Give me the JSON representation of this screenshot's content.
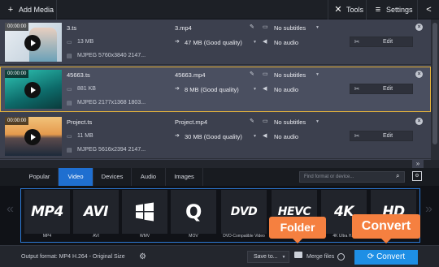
{
  "toolbar": {
    "add_media": "Add Media",
    "tools": "Tools",
    "settings": "Settings"
  },
  "files": [
    {
      "duration": "00:00:00",
      "name": "3.ts",
      "size": "13 MB",
      "codec": "MJPEG 5760x3840 2147...",
      "output_name": "3.mp4",
      "output_size": "47 MB (Good quality)",
      "subtitles": "No subtitles",
      "audio": "No audio",
      "edit": "Edit",
      "selected": false
    },
    {
      "duration": "00:00:00",
      "name": "45663.ts",
      "size": "881 KB",
      "codec": "MJPEG 2177x1368 1803...",
      "output_name": "45663.mp4",
      "output_size": "8 MB (Good quality)",
      "subtitles": "No subtitles",
      "audio": "No audio",
      "edit": "Edit",
      "selected": true
    },
    {
      "duration": "00:00:00",
      "name": "Project.ts",
      "size": "11 MB",
      "codec": "MJPEG 5616x2394 2147...",
      "output_name": "Project.mp4",
      "output_size": "30 MB (Good quality)",
      "subtitles": "No subtitles",
      "audio": "No audio",
      "edit": "Edit",
      "selected": false
    }
  ],
  "tabs": [
    "Popular",
    "Video",
    "Devices",
    "Audio",
    "Images"
  ],
  "active_tab": "Video",
  "search": {
    "placeholder": "Find format or device..."
  },
  "formats": [
    {
      "logo": "MP4",
      "label": "MP4"
    },
    {
      "logo": "AVI",
      "label": "AVI"
    },
    {
      "logo": "",
      "label": "WMV"
    },
    {
      "logo": "Q",
      "label": "MOV"
    },
    {
      "logo": "DVD",
      "label": "DVD-Compatible Video"
    },
    {
      "logo": "HEVC",
      "label": ""
    },
    {
      "logo": "4K",
      "label": "4K Ultra H..."
    },
    {
      "logo": "HD",
      "label": ""
    }
  ],
  "bottom": {
    "output_format": "Output format: MP4 H.264 - Original Size",
    "save_to": "Save to...",
    "merge_files": "Merge files",
    "convert": "Convert"
  },
  "callouts": {
    "folder": "Folder",
    "convert": "Convert"
  },
  "colors": {
    "accent_blue": "#1e8fe5",
    "callout_orange": "#f58040",
    "selection_gold": "#e3b23c"
  }
}
